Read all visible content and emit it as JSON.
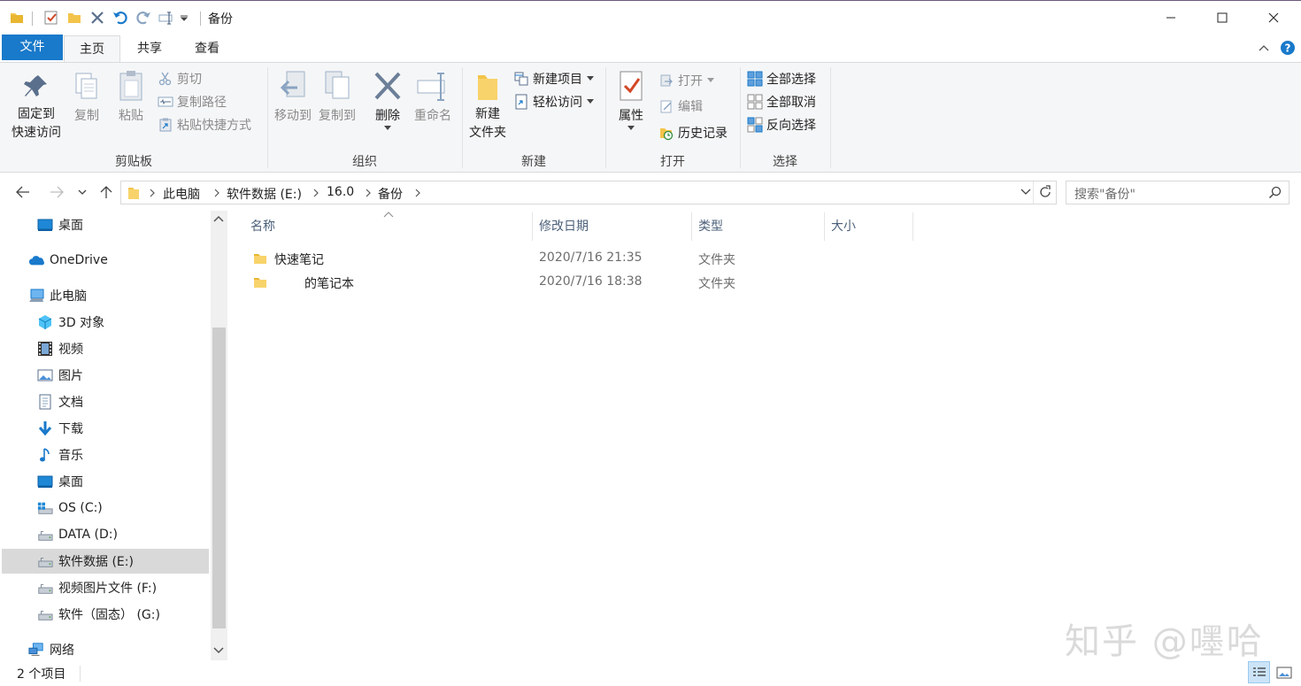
{
  "window": {
    "title": "备份",
    "minimize_glyph": "—",
    "close_glyph": "✕"
  },
  "ribbon_tabs": [
    {
      "label": "文件"
    },
    {
      "label": "主页"
    },
    {
      "label": "共享"
    },
    {
      "label": "查看"
    }
  ],
  "ribbon": {
    "clipboard": {
      "label": "剪贴板",
      "pin_line1": "固定到",
      "pin_line2": "快速访问",
      "copy": "复制",
      "paste": "粘贴",
      "cut": "剪切",
      "copy_path": "复制路径",
      "paste_shortcut": "粘贴快捷方式"
    },
    "organize": {
      "label": "组织",
      "move_to": "移动到",
      "copy_to": "复制到",
      "delete": "删除",
      "rename": "重命名"
    },
    "new": {
      "label": "新建",
      "new_folder_line1": "新建",
      "new_folder_line2": "文件夹",
      "new_item": "新建项目",
      "easy_access": "轻松访问"
    },
    "open": {
      "label": "打开",
      "properties": "属性",
      "open": "打开",
      "edit": "编辑",
      "history": "历史记录"
    },
    "select": {
      "label": "选择",
      "select_all": "全部选择",
      "select_none": "全部取消",
      "invert": "反向选择"
    }
  },
  "address": {
    "crumbs": [
      "此电脑",
      "软件数据 (E:)",
      "16.0",
      "备份"
    ],
    "search_placeholder": "搜索\"备份\""
  },
  "nav_items": [
    {
      "label": "桌面",
      "icon": "desktop-icon"
    },
    {
      "label": "OneDrive",
      "icon": "onedrive-icon"
    },
    {
      "label": "此电脑",
      "icon": "this-pc-icon"
    },
    {
      "label": "3D 对象",
      "icon": "3d-objects-icon"
    },
    {
      "label": "视频",
      "icon": "video-icon"
    },
    {
      "label": "图片",
      "icon": "pictures-icon"
    },
    {
      "label": "文档",
      "icon": "documents-icon"
    },
    {
      "label": "下载",
      "icon": "downloads-icon"
    },
    {
      "label": "音乐",
      "icon": "music-icon"
    },
    {
      "label": "桌面",
      "icon": "desktop-icon"
    },
    {
      "label": "OS (C:)",
      "icon": "windows-drive-icon"
    },
    {
      "label": "DATA (D:)",
      "icon": "drive-icon"
    },
    {
      "label": "软件数据 (E:)",
      "icon": "drive-icon",
      "selected": true
    },
    {
      "label": "视频图片文件 (F:)",
      "icon": "drive-icon"
    },
    {
      "label": "软件（固态） (G:)",
      "icon": "drive-icon"
    },
    {
      "label": "网络",
      "icon": "network-icon"
    }
  ],
  "columns": {
    "name": "名称",
    "modified": "修改日期",
    "type": "类型",
    "size": "大小"
  },
  "files": [
    {
      "name": "快速笔记",
      "modified": "2020/7/16 21:35",
      "type": "文件夹"
    },
    {
      "name": "的笔记本",
      "modified": "2020/7/16 18:38",
      "type": "文件夹"
    }
  ],
  "status": {
    "count": "2 个项目"
  },
  "watermark": "知乎 @嚜哈",
  "colors": {
    "accent": "#1979ca",
    "folder": "#f3c44a",
    "selected_bg": "#d9d9d9"
  }
}
